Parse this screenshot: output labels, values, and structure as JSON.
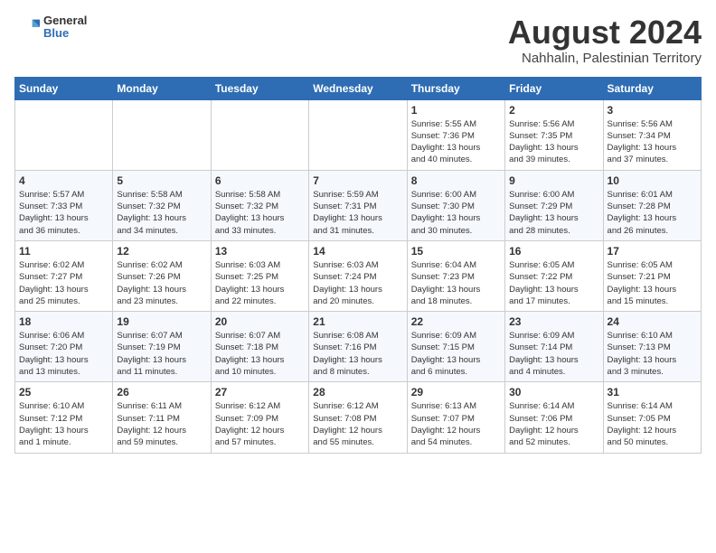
{
  "header": {
    "logo_general": "General",
    "logo_blue": "Blue",
    "month_year": "August 2024",
    "location": "Nahhalin, Palestinian Territory"
  },
  "days_of_week": [
    "Sunday",
    "Monday",
    "Tuesday",
    "Wednesday",
    "Thursday",
    "Friday",
    "Saturday"
  ],
  "weeks": [
    [
      {
        "day": "",
        "text": ""
      },
      {
        "day": "",
        "text": ""
      },
      {
        "day": "",
        "text": ""
      },
      {
        "day": "",
        "text": ""
      },
      {
        "day": "1",
        "text": "Sunrise: 5:55 AM\nSunset: 7:36 PM\nDaylight: 13 hours\nand 40 minutes."
      },
      {
        "day": "2",
        "text": "Sunrise: 5:56 AM\nSunset: 7:35 PM\nDaylight: 13 hours\nand 39 minutes."
      },
      {
        "day": "3",
        "text": "Sunrise: 5:56 AM\nSunset: 7:34 PM\nDaylight: 13 hours\nand 37 minutes."
      }
    ],
    [
      {
        "day": "4",
        "text": "Sunrise: 5:57 AM\nSunset: 7:33 PM\nDaylight: 13 hours\nand 36 minutes."
      },
      {
        "day": "5",
        "text": "Sunrise: 5:58 AM\nSunset: 7:32 PM\nDaylight: 13 hours\nand 34 minutes."
      },
      {
        "day": "6",
        "text": "Sunrise: 5:58 AM\nSunset: 7:32 PM\nDaylight: 13 hours\nand 33 minutes."
      },
      {
        "day": "7",
        "text": "Sunrise: 5:59 AM\nSunset: 7:31 PM\nDaylight: 13 hours\nand 31 minutes."
      },
      {
        "day": "8",
        "text": "Sunrise: 6:00 AM\nSunset: 7:30 PM\nDaylight: 13 hours\nand 30 minutes."
      },
      {
        "day": "9",
        "text": "Sunrise: 6:00 AM\nSunset: 7:29 PM\nDaylight: 13 hours\nand 28 minutes."
      },
      {
        "day": "10",
        "text": "Sunrise: 6:01 AM\nSunset: 7:28 PM\nDaylight: 13 hours\nand 26 minutes."
      }
    ],
    [
      {
        "day": "11",
        "text": "Sunrise: 6:02 AM\nSunset: 7:27 PM\nDaylight: 13 hours\nand 25 minutes."
      },
      {
        "day": "12",
        "text": "Sunrise: 6:02 AM\nSunset: 7:26 PM\nDaylight: 13 hours\nand 23 minutes."
      },
      {
        "day": "13",
        "text": "Sunrise: 6:03 AM\nSunset: 7:25 PM\nDaylight: 13 hours\nand 22 minutes."
      },
      {
        "day": "14",
        "text": "Sunrise: 6:03 AM\nSunset: 7:24 PM\nDaylight: 13 hours\nand 20 minutes."
      },
      {
        "day": "15",
        "text": "Sunrise: 6:04 AM\nSunset: 7:23 PM\nDaylight: 13 hours\nand 18 minutes."
      },
      {
        "day": "16",
        "text": "Sunrise: 6:05 AM\nSunset: 7:22 PM\nDaylight: 13 hours\nand 17 minutes."
      },
      {
        "day": "17",
        "text": "Sunrise: 6:05 AM\nSunset: 7:21 PM\nDaylight: 13 hours\nand 15 minutes."
      }
    ],
    [
      {
        "day": "18",
        "text": "Sunrise: 6:06 AM\nSunset: 7:20 PM\nDaylight: 13 hours\nand 13 minutes."
      },
      {
        "day": "19",
        "text": "Sunrise: 6:07 AM\nSunset: 7:19 PM\nDaylight: 13 hours\nand 11 minutes."
      },
      {
        "day": "20",
        "text": "Sunrise: 6:07 AM\nSunset: 7:18 PM\nDaylight: 13 hours\nand 10 minutes."
      },
      {
        "day": "21",
        "text": "Sunrise: 6:08 AM\nSunset: 7:16 PM\nDaylight: 13 hours\nand 8 minutes."
      },
      {
        "day": "22",
        "text": "Sunrise: 6:09 AM\nSunset: 7:15 PM\nDaylight: 13 hours\nand 6 minutes."
      },
      {
        "day": "23",
        "text": "Sunrise: 6:09 AM\nSunset: 7:14 PM\nDaylight: 13 hours\nand 4 minutes."
      },
      {
        "day": "24",
        "text": "Sunrise: 6:10 AM\nSunset: 7:13 PM\nDaylight: 13 hours\nand 3 minutes."
      }
    ],
    [
      {
        "day": "25",
        "text": "Sunrise: 6:10 AM\nSunset: 7:12 PM\nDaylight: 13 hours\nand 1 minute."
      },
      {
        "day": "26",
        "text": "Sunrise: 6:11 AM\nSunset: 7:11 PM\nDaylight: 12 hours\nand 59 minutes."
      },
      {
        "day": "27",
        "text": "Sunrise: 6:12 AM\nSunset: 7:09 PM\nDaylight: 12 hours\nand 57 minutes."
      },
      {
        "day": "28",
        "text": "Sunrise: 6:12 AM\nSunset: 7:08 PM\nDaylight: 12 hours\nand 55 minutes."
      },
      {
        "day": "29",
        "text": "Sunrise: 6:13 AM\nSunset: 7:07 PM\nDaylight: 12 hours\nand 54 minutes."
      },
      {
        "day": "30",
        "text": "Sunrise: 6:14 AM\nSunset: 7:06 PM\nDaylight: 12 hours\nand 52 minutes."
      },
      {
        "day": "31",
        "text": "Sunrise: 6:14 AM\nSunset: 7:05 PM\nDaylight: 12 hours\nand 50 minutes."
      }
    ]
  ]
}
